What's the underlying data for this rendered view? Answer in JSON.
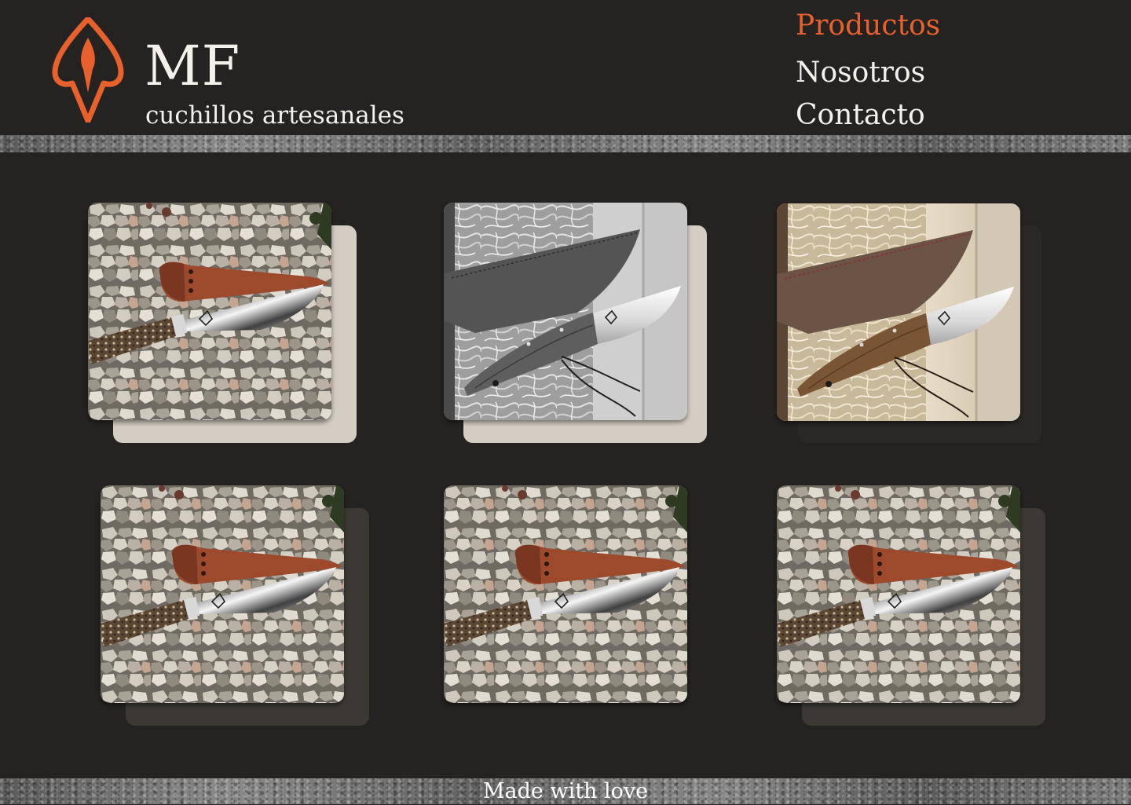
{
  "header": {
    "logo_icon": "arrowhead-leaf-icon",
    "title": "MF",
    "subtitle": "cuchillos artesanales"
  },
  "nav": {
    "items": [
      {
        "label": "Productos",
        "active": true
      },
      {
        "label": "Nosotros",
        "active": false
      },
      {
        "label": "Contacto",
        "active": false
      }
    ]
  },
  "colors": {
    "accent": "#e8612c",
    "background": "#252321",
    "text": "#f4f1ec",
    "card_backing_light": "#d4cdc3",
    "card_backing_dark": "#3c3934"
  },
  "gallery": {
    "items": [
      {
        "photo": "knife-on-gravel-photo",
        "style": "color"
      },
      {
        "photo": "knife-in-wooden-box-photo",
        "style": "grayscale"
      },
      {
        "photo": "knife-in-wooden-box-photo",
        "style": "color"
      },
      {
        "photo": "knife-on-gravel-photo",
        "style": "color"
      },
      {
        "photo": "knife-on-gravel-photo",
        "style": "color"
      },
      {
        "photo": "knife-on-gravel-photo",
        "style": "color"
      }
    ]
  },
  "footer": {
    "text": "Made with love"
  }
}
